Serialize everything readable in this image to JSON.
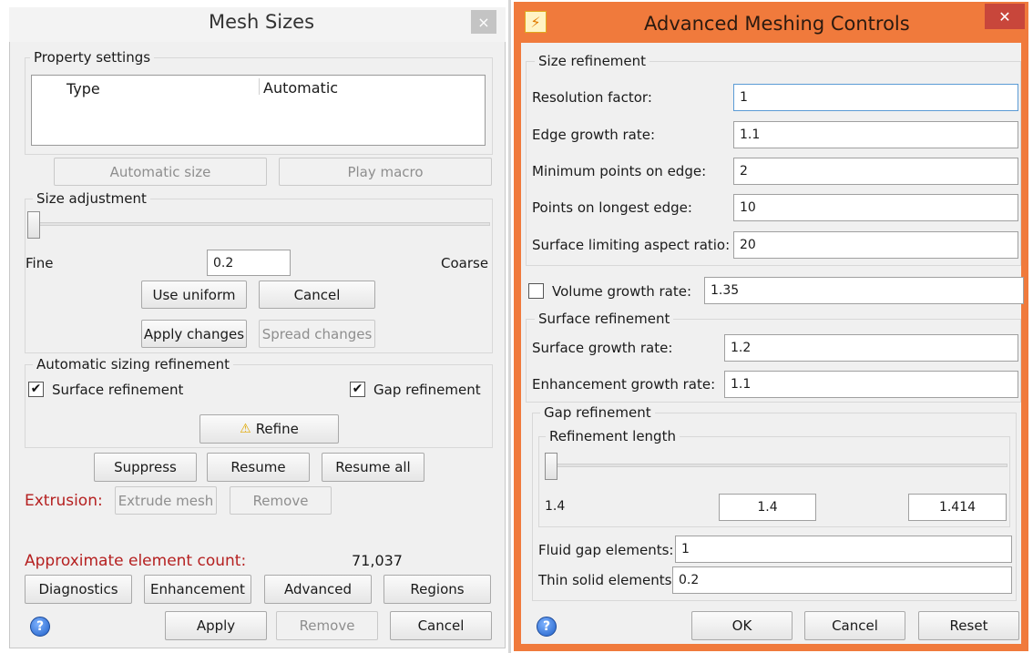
{
  "left": {
    "title": "Mesh Sizes",
    "close_glyph": "×",
    "property_settings": {
      "title": "Property settings",
      "col_type": "Type",
      "col_automatic": "Automatic"
    },
    "automatic_size": "Automatic size",
    "play_macro": "Play macro",
    "size_adjustment": {
      "title": "Size adjustment",
      "fine": "Fine",
      "coarse": "Coarse",
      "value": "0.2"
    },
    "use_uniform": "Use uniform",
    "cancel": "Cancel",
    "apply_changes": "Apply changes",
    "spread_changes": "Spread changes",
    "auto_refinement": {
      "title": "Automatic sizing refinement",
      "surface": "Surface refinement",
      "gap": "Gap refinement",
      "refine": "Refine"
    },
    "suppress": "Suppress",
    "resume": "Resume",
    "resume_all": "Resume all",
    "extrusion_label": "Extrusion:",
    "extrude_mesh": "Extrude mesh",
    "remove": "Remove",
    "approx_label": "Approximate element count:",
    "approx_value": "71,037",
    "diagnostics": "Diagnostics",
    "enhancement": "Enhancement",
    "advanced": "Advanced",
    "regions": "Regions",
    "apply": "Apply",
    "remove_bottom": "Remove",
    "cancel_bottom": "Cancel"
  },
  "right": {
    "title": "Advanced Meshing Controls",
    "close_glyph": "✕",
    "size_refinement": {
      "title": "Size refinement",
      "resolution_label": "Resolution factor:",
      "resolution_value": "1",
      "edge_label": "Edge growth rate:",
      "edge_value": "1.1",
      "minpts_label": "Minimum points on edge:",
      "minpts_value": "2",
      "longest_label": "Points on longest edge:",
      "longest_value": "10",
      "aspect_label": "Surface limiting aspect ratio:",
      "aspect_value": "20"
    },
    "volume_label": "Volume growth rate:",
    "volume_value": "1.35",
    "surface_refinement": {
      "title": "Surface refinement",
      "surface_label": "Surface growth rate:",
      "surface_value": "1.2",
      "enhancement_label": "Enhancement growth rate:",
      "enhancement_value": "1.1"
    },
    "gap_refinement": {
      "title": "Gap refinement",
      "ref_length_title": "Refinement length",
      "min_label": "1.4",
      "current_value": "1.4",
      "max_value": "1.414",
      "fluid_label": "Fluid gap elements:",
      "fluid_value": "1",
      "thin_label": "Thin solid elements:",
      "thin_value": "0.2"
    },
    "ok": "OK",
    "cancel": "Cancel",
    "reset": "Reset"
  },
  "colors": {
    "orange_frame": "#f07a3c",
    "extrusion_red": "#b52020",
    "close_red": "#c8463b"
  }
}
